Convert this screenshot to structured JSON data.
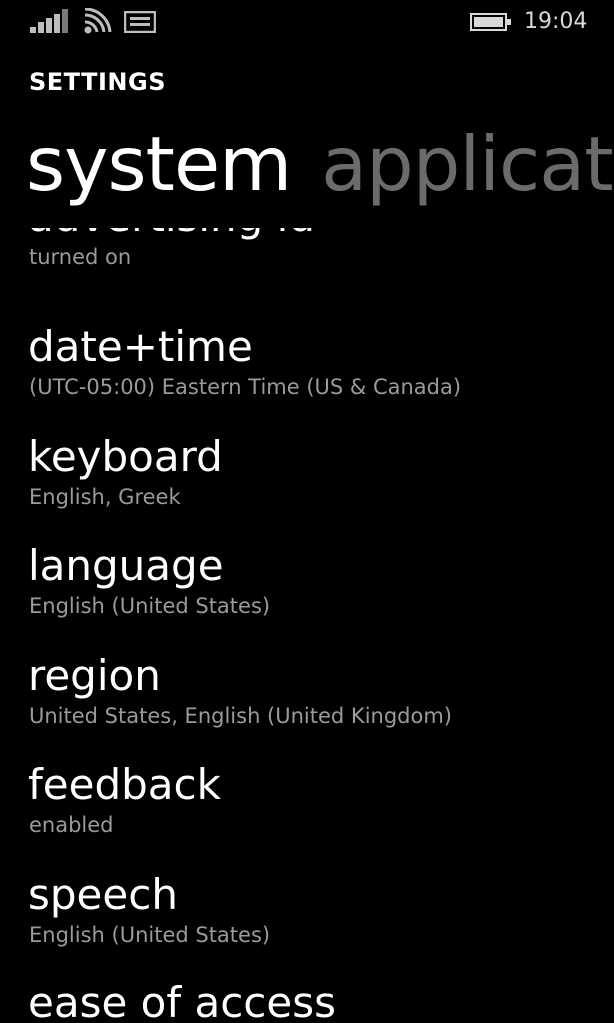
{
  "status_bar": {
    "signal_icon": "cellular-signal-icon",
    "wifi_icon": "wifi-icon",
    "message_icon": "message-icon",
    "battery_icon": "battery-icon",
    "time": "19:04"
  },
  "header": {
    "title": "SETTINGS",
    "pivots": [
      {
        "label": "system"
      },
      {
        "label": "applications"
      }
    ]
  },
  "settings": [
    {
      "title": "advertising id",
      "subtitle": "turned on"
    },
    {
      "title": "date+time",
      "subtitle": "(UTC-05:00) Eastern Time (US & Canada)"
    },
    {
      "title": "keyboard",
      "subtitle": "English, Greek"
    },
    {
      "title": "language",
      "subtitle": "English (United States)"
    },
    {
      "title": "region",
      "subtitle": "United States, English (United Kingdom)"
    },
    {
      "title": "feedback",
      "subtitle": "enabled"
    },
    {
      "title": "speech",
      "subtitle": "English (United States)"
    },
    {
      "title": "ease of access",
      "subtitle": ""
    }
  ],
  "colors": {
    "background": "#000000",
    "primary_text": "#ffffff",
    "secondary_text": "#9a9a9a",
    "inactive_pivot": "#6b6b6b"
  }
}
